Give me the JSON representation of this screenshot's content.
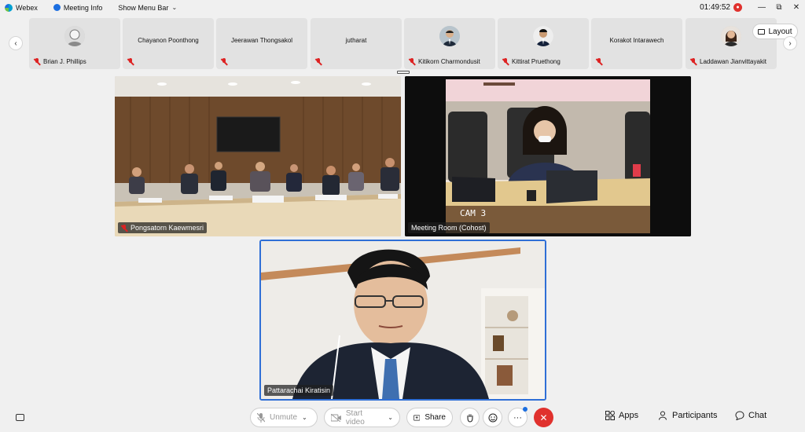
{
  "titlebar": {
    "app_name": "Webex",
    "meeting_info": "Meeting Info",
    "show_menu_bar": "Show Menu Bar",
    "time": "01:49:52",
    "rec_badge": "●",
    "minimize": "—",
    "restore": "⧉",
    "close": "✕"
  },
  "filmstrip": {
    "prev": "‹",
    "next": "›",
    "participants": [
      {
        "name": "Brian J. Phillips",
        "has_avatar": true,
        "muted": true
      },
      {
        "name": "Chayanon Poonthong",
        "has_avatar": false,
        "muted": true
      },
      {
        "name": "Jeerawan Thongsakol",
        "has_avatar": false,
        "muted": true
      },
      {
        "name": "jutharat",
        "has_avatar": false,
        "muted": true
      },
      {
        "name": "Kitikorn Charmondusit",
        "has_avatar": true,
        "muted": true
      },
      {
        "name": "Kittirat Pruethong",
        "has_avatar": true,
        "muted": true
      },
      {
        "name": "Korakot Intarawech",
        "has_avatar": false,
        "muted": true
      },
      {
        "name": "Laddawan Jianvittayakit",
        "has_avatar": true,
        "muted": true
      }
    ],
    "layout_label": "Layout"
  },
  "videos": [
    {
      "name": "Pongsatorn Kaewmesri",
      "muted": true
    },
    {
      "name": "Meeting Room (Cohost)",
      "muted": false,
      "cam_label": "CAM 3"
    },
    {
      "name": "Pattarachai Kiratisin",
      "muted": false
    }
  ],
  "controls": {
    "unmute": "Unmute",
    "start_video": "Start video",
    "share": "Share",
    "more": "···",
    "end": "✕",
    "apps": "Apps",
    "participants": "Participants",
    "chat": "Chat"
  },
  "colors": {
    "accent": "#2f6fd6",
    "end_call": "#e0312d",
    "muted_icon": "#dd2222"
  }
}
